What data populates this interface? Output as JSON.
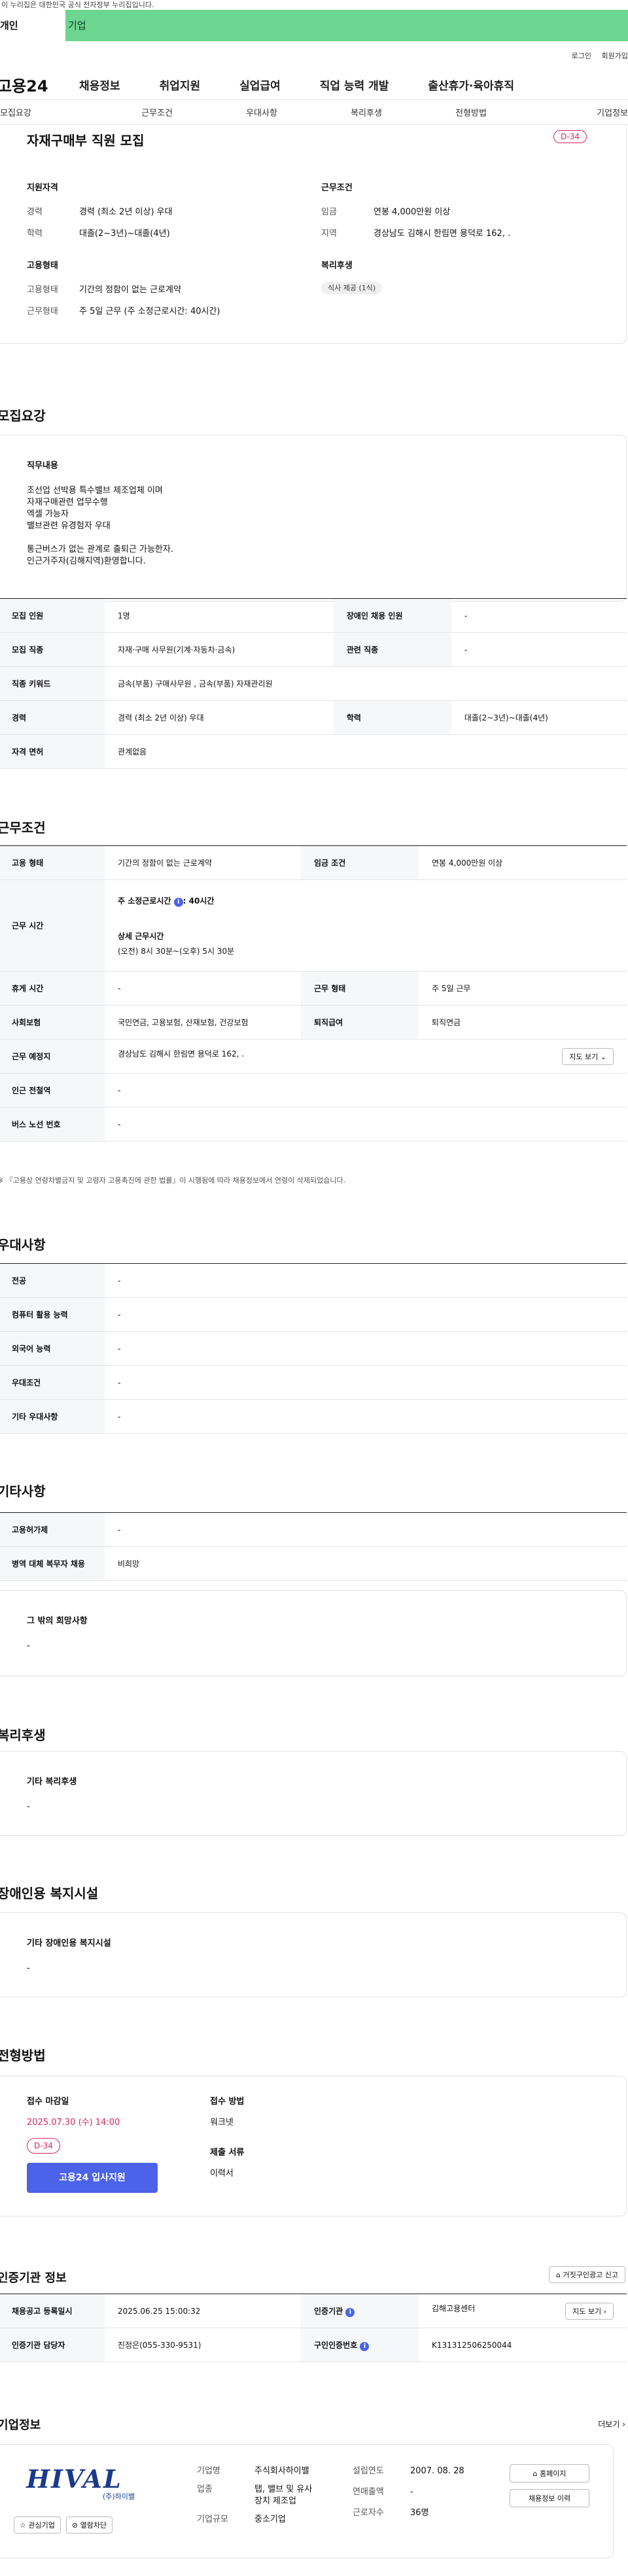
{
  "top_notice": "이 누리집은 대한민국 공식 전자정부 누리집입니다.",
  "member_tabs": {
    "person": "개인",
    "company": "기업"
  },
  "util_links": {
    "login": "로그인",
    "join": "회원가입"
  },
  "logo": "고용24",
  "gnb": [
    "채용정보",
    "취업지원",
    "실업급여",
    "직업 능력 개발",
    "출산휴가·육아휴직"
  ],
  "anchor_nav": [
    "모집요강",
    "근무조건",
    "우대사항",
    "복리후생",
    "전형방법",
    "기업정보"
  ],
  "summary": {
    "title": "자재구매부 직원 모집",
    "dday": "D-34",
    "qual_title": "지원자격",
    "career_k": "경력",
    "career_v": "경력 (최소 2년 이상) 우대",
    "edu_k": "학력",
    "edu_v": "대졸(2~3년)~대졸(4년)",
    "emp_title": "고용형태",
    "emp_k": "고용형태",
    "emp_v": "기간의 정함이 없는 근로계약",
    "form_k": "근무형태",
    "form_v": "주 5일 근무 (주 소정근로시간: 40시간)",
    "cond_title": "근무조건",
    "wage_k": "임금",
    "wage_v": "연봉 4,000만원 이상",
    "area_k": "지역",
    "area_v": "경상남도 김해시 한림면 용덕로 162, .",
    "welfare_title": "복리후생",
    "welfare_badge": "식사 제공 (1식)"
  },
  "recruit": {
    "title": "모집요강",
    "duty_h": "직무내용",
    "duty_lines": [
      "조선업 선박용 특수밸브 제조업체 이며",
      "자재구매관련 업무수행",
      "엑셀 가능자",
      "밸브관련 유경험자 우대",
      "",
      "통근버스가 없는 관계로 출퇴근 가능한자.",
      "인근거주자(김해지역)환영합니다."
    ],
    "rows": [
      [
        "모집 인원",
        "1명",
        "장애인 채용 인원",
        "-"
      ],
      [
        "모집 직종",
        "자재·구매 사무원(기계·자동차·금속)",
        "관련 직종",
        "-"
      ],
      [
        "직종 키워드",
        "금속(부품) 구매사무원 , 금속(부품) 자재관리원",
        "",
        ""
      ],
      [
        "경력",
        "경력 (최소 2년 이상) 우대",
        "학력",
        "대졸(2~3년)~대졸(4년)"
      ],
      [
        "자격 면허",
        "관계없음",
        "",
        ""
      ]
    ]
  },
  "conditions": {
    "title": "근무조건",
    "emp_type_k": "고용 형태",
    "emp_type_v": "기간의 정함이 없는 근로계약",
    "wage_k": "임금 조건",
    "wage_v": "연봉 4,000만원 이상",
    "hours_k": "근무 시간",
    "hours_line1_label": "주 소정근로시간",
    "hours_line1_value": ": 40시간",
    "hours_detail_label": "상세 근무시간",
    "hours_detail_value": "(오전) 8시 30분~(오후) 5시 30분",
    "rest_k": "휴게 시간",
    "rest_v": "-",
    "form_k": "근무 형태",
    "form_v": "주 5일 근무",
    "insure_k": "사회보험",
    "insure_v": "국민연금, 고용보험, 산재보험, 건강보험",
    "severance_k": "퇴직급여",
    "severance_v": "퇴직연금",
    "place_k": "근무 예정지",
    "place_v": "경상남도 김해시 한림면 용덕로 162, .",
    "map_btn": "지도 보기",
    "station_k": "인근 전철역",
    "station_v": "-",
    "bus_k": "버스 노선 번호",
    "bus_v": "-",
    "note": "※ 『고용상 연령차별금지 및 고령자 고용촉진에 관한 법률』이 시행됨에 따라 채용정보에서 연령이 삭제되었습니다."
  },
  "preference": {
    "title": "우대사항",
    "rows": [
      [
        "전공",
        "-"
      ],
      [
        "컴퓨터 활용 능력",
        "-"
      ],
      [
        "외국어 능력",
        "-"
      ],
      [
        "우대조건",
        "-"
      ],
      [
        "기타 우대사항",
        "-"
      ]
    ]
  },
  "etc": {
    "title": "기타사항",
    "rows": [
      [
        "고용허가제",
        "-"
      ],
      [
        "병역 대체 복무자 채용",
        "비희망"
      ]
    ],
    "box_h": "그 밖의 희망사항",
    "box_v": "-"
  },
  "welfare": {
    "title": "복리후생",
    "box_h": "기타 복리후생",
    "box_v": "-"
  },
  "disability": {
    "title": "장애인용 복지시설",
    "box_h": "기타 장애인용 복지시설",
    "box_v": "-"
  },
  "process": {
    "title": "전형방법",
    "deadline_h": "접수 마감일",
    "deadline_v": "2025.07.30 (수) 14:00",
    "dday": "D-34",
    "apply_btn": "고용24 입사지원",
    "method_h": "접수 방법",
    "method_v": "워크넷",
    "docs_h": "제출 서류",
    "docs_v": "이력서"
  },
  "agency": {
    "title": "인증기관 정보",
    "report_btn": "거짓구인광고 신고",
    "reg_k": "채용공고 등록일시",
    "reg_v": "2025.06.25 15:00:32",
    "org_k": "인증기관",
    "org_v": "김해고용센터",
    "map_btn": "지도 보기",
    "staff_k": "인증기관 담당자",
    "staff_v": "진정은(055-330-9531)",
    "no_k": "구인인증번호",
    "no_v": "K131312506250044"
  },
  "company": {
    "title": "기업정보",
    "more": "더보기",
    "logo_text": "HIVAL",
    "logo_sub": "(주)하이밸",
    "fav_btn": "관심기업",
    "block_btn": "열람차단",
    "name_k": "기업명",
    "name_v": "주식회사하이밸",
    "biz_k": "업종",
    "biz_v1": "탭, 밸브 및 유사",
    "biz_v2": "장치 제조업",
    "size_k": "기업규모",
    "size_v": "중소기업",
    "est_k": "설립연도",
    "est_v": "2007. 08. 28",
    "sales_k": "연매출액",
    "sales_v": "-",
    "emp_k": "근로자수",
    "emp_v": "36명",
    "home_btn": "홈페이지",
    "history_btn": "채용정보 이력"
  }
}
